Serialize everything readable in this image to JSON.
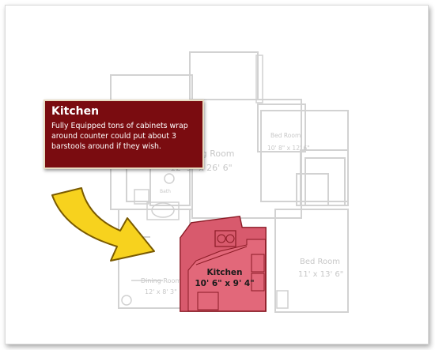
{
  "callout": {
    "title": "Kitchen",
    "description": "Fully Equipped tons of cabinets wrap around counter could put about 3 barstools around if they wish."
  },
  "kitchen": {
    "name": "Kitchen",
    "dimensions": "10' 6\" x 9' 4\""
  },
  "rooms": {
    "living": {
      "name": "Living Room",
      "dimensions": "12' 9\" x 26' 6\""
    },
    "bedroom1": {
      "name": "Bed Room",
      "dimensions": "10' 8\" x 12' 6\""
    },
    "bedroom2": {
      "name": "Bed Room",
      "dimensions": "11' x 13' 6\""
    },
    "dining": {
      "name": "Dining Room",
      "dimensions": "12' x 8' 3\""
    },
    "bath": {
      "name": "Bath"
    }
  },
  "colors": {
    "callout_bg": "#7a0c10",
    "arrow_fill": "#f7d21e",
    "arrow_stroke": "#7a5a00",
    "kitchen_fill": "#e2687a",
    "plan_line": "#d2d2d2"
  }
}
